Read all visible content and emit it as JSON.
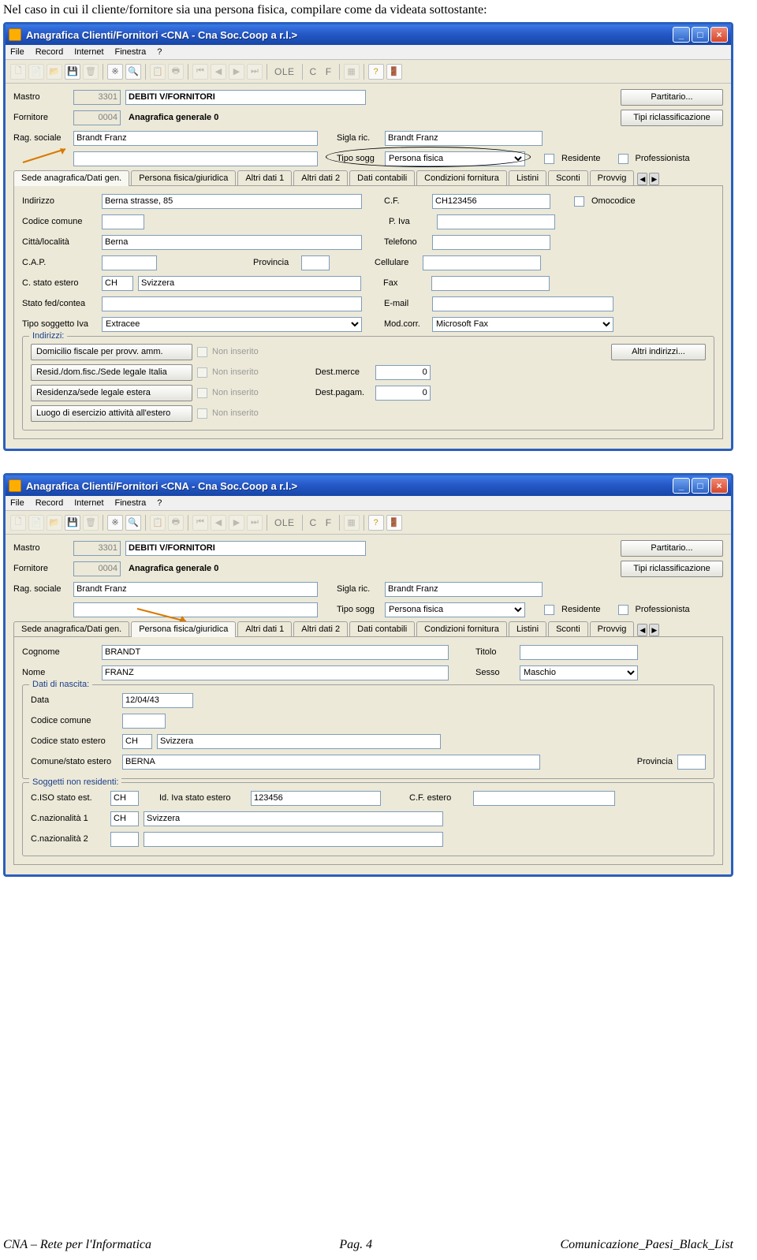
{
  "intro": "Nel caso in cui il cliente/fornitore sia una persona fisica, compilare come da videata sottostante:",
  "win_title": "Anagrafica Clienti/Fornitori <CNA - Cna Soc.Coop a r.l.>",
  "menu": {
    "m1": "File",
    "m2": "Record",
    "m3": "Internet",
    "m4": "Finestra",
    "m5": "?"
  },
  "toolbar": {
    "ole": "OLE",
    "c": "C",
    "f": "F"
  },
  "buttons": {
    "part": "Partitario...",
    "ricl": "Tipi riclassificazione",
    "altri": "Altri indirizzi..."
  },
  "header": {
    "mastro_lbl": "Mastro",
    "mastro_code": "3301",
    "mastro_desc": "DEBITI V/FORNITORI",
    "forn_lbl": "Fornitore",
    "forn_code": "0004",
    "forn_desc": "Anagrafica generale 0",
    "rag_lbl": "Rag. sociale",
    "rag_val": "Brandt Franz",
    "sigla_lbl": "Sigla ric.",
    "sigla_val": "Brandt Franz",
    "tipo_lbl": "Tipo sogg",
    "tipo_val": "Persona fisica",
    "res_lbl": "Residente",
    "prof_lbl": "Professionista"
  },
  "tabs": {
    "t1": "Sede anagrafica/Dati gen.",
    "t2": "Persona fisica/giuridica",
    "t3": "Altri dati 1",
    "t4": "Altri dati 2",
    "t5": "Dati contabili",
    "t6": "Condizioni fornitura",
    "t7": "Listini",
    "t8": "Sconti",
    "t9": "Provvig"
  },
  "tab1": {
    "ind_lbl": "Indirizzo",
    "ind_val": "Berna strasse, 85",
    "cf_lbl": "C.F.",
    "cf_val": "CH123456",
    "omo_lbl": "Omocodice",
    "cod_com_lbl": "Codice comune",
    "piva_lbl": "P. Iva",
    "citta_lbl": "Città/località",
    "citta_val": "Berna",
    "tel_lbl": "Telefono",
    "cap_lbl": "C.A.P.",
    "prov_lbl": "Provincia",
    "cel_lbl": "Cellulare",
    "cstato_lbl": "C. stato estero",
    "cstato_val": "CH",
    "stato_desc": "Svizzera",
    "fax_lbl": "Fax",
    "sfed_lbl": "Stato fed/contea",
    "email_lbl": "E-mail",
    "tiva_lbl": "Tipo soggetto Iva",
    "tiva_val": "Extracee",
    "mod_lbl": "Mod.corr.",
    "mod_val": "Microsoft Fax",
    "fs_legend": "Indirizzi:",
    "b1": "Domicilio fiscale per provv. amm.",
    "b2": "Resid./dom.fisc./Sede legale Italia",
    "b3": "Residenza/sede legale estera",
    "b4": "Luogo di esercizio attività all'estero",
    "nonins": "Non inserito",
    "dm_lbl": "Dest.merce",
    "dm_val": "0",
    "dp_lbl": "Dest.pagam.",
    "dp_val": "0"
  },
  "tab2": {
    "cog_lbl": "Cognome",
    "cog_val": "BRANDT",
    "tit_lbl": "Titolo",
    "nome_lbl": "Nome",
    "nome_val": "FRANZ",
    "sex_lbl": "Sesso",
    "sex_val": "Maschio",
    "nasc_legend": "Dati di nascita:",
    "data_lbl": "Data",
    "data_val": "12/04/43",
    "codcom_lbl": "Codice comune",
    "codst_lbl": "Codice stato estero",
    "codst_val": "CH",
    "codst_desc": "Svizzera",
    "comst_lbl": "Comune/stato estero",
    "comst_val": "BERNA",
    "prov_lbl": "Provincia",
    "nr_legend": "Soggetti non residenti:",
    "ciso_lbl": "C.ISO stato est.",
    "ciso_val": "CH",
    "idiva_lbl": "Id. Iva stato estero",
    "idiva_val": "123456",
    "cfest_lbl": "C.F. estero",
    "cnaz1_lbl": "C.nazionalità 1",
    "cnaz1_val": "CH",
    "cnaz1_desc": "Svizzera",
    "cnaz2_lbl": "C.nazionalità 2"
  },
  "footer": {
    "left": "CNA – Rete per l'Informatica",
    "center": "Pag. 4",
    "right": "Comunicazione_Paesi_Black_List"
  }
}
